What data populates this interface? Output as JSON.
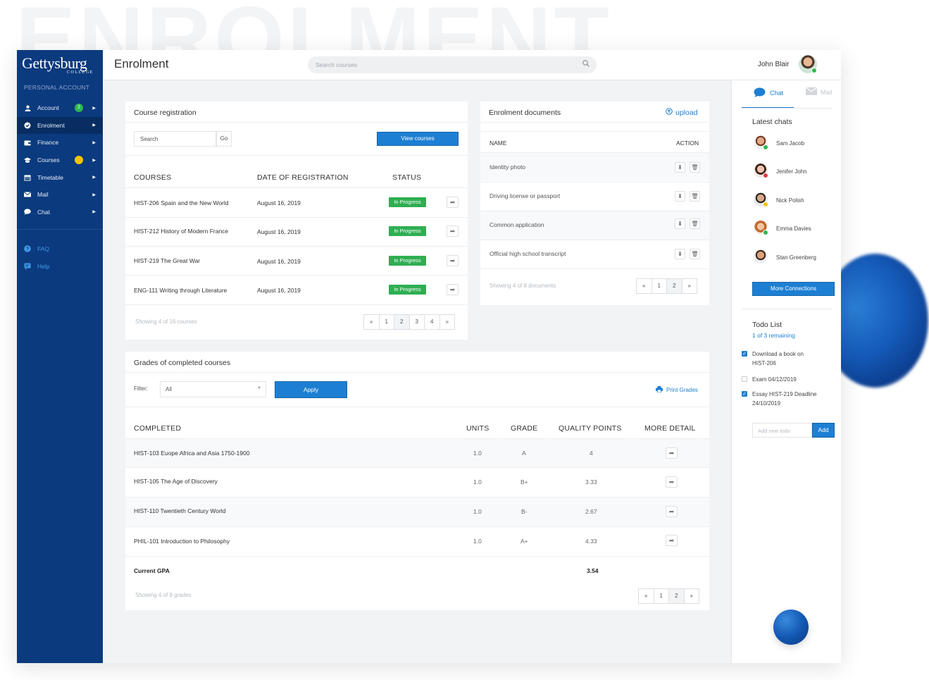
{
  "background_word": "ENROLMENT",
  "logo": {
    "main": "Gettysburg",
    "sub": "COLLEGE"
  },
  "sidebar": {
    "section_label": "PERSONAL ACCOUNT",
    "items": [
      {
        "label": "Account",
        "icon": "user-icon",
        "badge": "2"
      },
      {
        "label": "Enrolment",
        "icon": "check-circle-icon"
      },
      {
        "label": "Finance",
        "icon": "wallet-icon"
      },
      {
        "label": "Courses",
        "icon": "graduation-cap-icon",
        "badge": ""
      },
      {
        "label": "Timetable",
        "icon": "calendar-icon"
      },
      {
        "label": "Mail",
        "icon": "mail-icon"
      },
      {
        "label": "Chat",
        "icon": "chat-bubble-icon"
      }
    ],
    "help_items": [
      {
        "label": "FAQ",
        "icon": "question-icon"
      },
      {
        "label": "Help",
        "icon": "help-message-icon"
      }
    ]
  },
  "header": {
    "title": "Enrolment",
    "search_placeholder": "Search courses",
    "user_name": "John Blair"
  },
  "course_registration": {
    "title": "Course registration",
    "search_placeholder": "Search",
    "go_label": "Go",
    "view_courses_label": "View courses",
    "columns": [
      "COURSES",
      "DATE OF REGISTRATION",
      "STATUS"
    ],
    "rows": [
      {
        "course": "HIST-206 Spain and the New World",
        "date": "August 16, 2019",
        "status": "In Progress"
      },
      {
        "course": "HIST-212 History of Modern France",
        "date": "August 16, 2019",
        "status": "In Progress"
      },
      {
        "course": "HIST-219 The Great War",
        "date": "August 16, 2019",
        "status": "In Progress"
      },
      {
        "course": "ENG-111 Writing through Literature",
        "date": "August 16, 2019",
        "status": "In Progress"
      }
    ],
    "showing": "Showing 4 of 16 courses",
    "pages": [
      "«",
      "1",
      "2",
      "3",
      "4",
      "»"
    ]
  },
  "enrolment_documents": {
    "title": "Enrolment documents",
    "upload_label": "upload",
    "columns": [
      "NAME",
      "ACTION"
    ],
    "rows": [
      "Identity photo",
      "Driving license or passport",
      "Common application",
      "Official high school transcript"
    ],
    "showing": "Showing 4 of 8 documents",
    "pages": [
      "«",
      "1",
      "2",
      "»"
    ]
  },
  "grades": {
    "title": "Grades of completed courses",
    "filter_label": "Filter:",
    "filter_value": "All",
    "apply_label": "Apply",
    "print_label": "Print Grades",
    "columns": [
      "COMPLETED",
      "UNITS",
      "GRADE",
      "QUALITY POINTS",
      "MORE DETAIL"
    ],
    "rows": [
      {
        "course": "HIST-103 Euope Africa and Asia 1750-1900",
        "units": "1.0",
        "grade": "A",
        "points": "4"
      },
      {
        "course": "HIST-105 The Age of Discovery",
        "units": "1.0",
        "grade": "B+",
        "points": "3.33"
      },
      {
        "course": "HIST-110 Twentieth Century World",
        "units": "1.0",
        "grade": "B-",
        "points": "2.67"
      },
      {
        "course": "PHIL-101 Introduction to Philosophy",
        "units": "1.0",
        "grade": "A+",
        "points": "4.33"
      }
    ],
    "gpa_label": "Current GPA",
    "gpa_value": "3.54",
    "showing": "Showing 4 of 8 grades",
    "pages": [
      "«",
      "1",
      "2",
      "»"
    ]
  },
  "right_panel": {
    "tabs": [
      {
        "label": "Chat",
        "icon": "chat-bubble-icon"
      },
      {
        "label": "Mail",
        "icon": "mail-icon"
      }
    ],
    "latest_chats_title": "Latest chats",
    "chats": [
      {
        "name": "Sam Jacob",
        "status": "#2db84d"
      },
      {
        "name": "Jenifer John",
        "status": "#e0393e"
      },
      {
        "name": "Nick Polish",
        "status": "#f5c400"
      },
      {
        "name": "Emma Davies",
        "status": "#2db84d"
      },
      {
        "name": "Stan Greenberg",
        "status": ""
      }
    ],
    "more_connections_label": "More Connections",
    "todo_title": "Todo List",
    "todo_remaining": "1 of 3 remaining",
    "todos": [
      {
        "text": "Download a book on HIST-206",
        "done": true
      },
      {
        "text": "Exam 04/12/2019",
        "done": false
      },
      {
        "text": "Essay HIST-219 Deadline 24/10/2019",
        "done": true
      }
    ],
    "todo_placeholder": "Add new todo",
    "todo_add_label": "Add"
  },
  "colors": {
    "sidebar": "#0b3a7e",
    "accent": "#1d7fd3",
    "success": "#2fae52"
  }
}
